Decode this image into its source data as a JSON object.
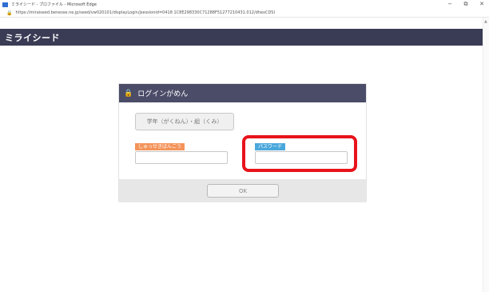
{
  "window": {
    "title": "ミライシード - プロファイル - Microsoft Edge",
    "controls": {
      "minimize": "−",
      "restore": "⧉",
      "close": "✕"
    }
  },
  "address": {
    "url": "https://miraiseed.benesse.ne.jp/seed/vw020101/displayLogin/jsessionid=0418 1C8E298330C71288F51277210431.012/dhexCDSI"
  },
  "header": {
    "logo": "ミライシード"
  },
  "login": {
    "title": "ログインがめん",
    "class_button": "学年（がくねん）・組（くみ）",
    "id_label": "しゅっせきばんごう",
    "password_label": "パスワード",
    "id_value": "",
    "password_value": "",
    "ok_button": "OK"
  },
  "colors": {
    "header_bg": "#3a3c55",
    "card_header_bg": "#4a4c68",
    "id_label_bg": "#f4945a",
    "password_label_bg": "#4aa8dc",
    "highlight": "#e8131b"
  }
}
